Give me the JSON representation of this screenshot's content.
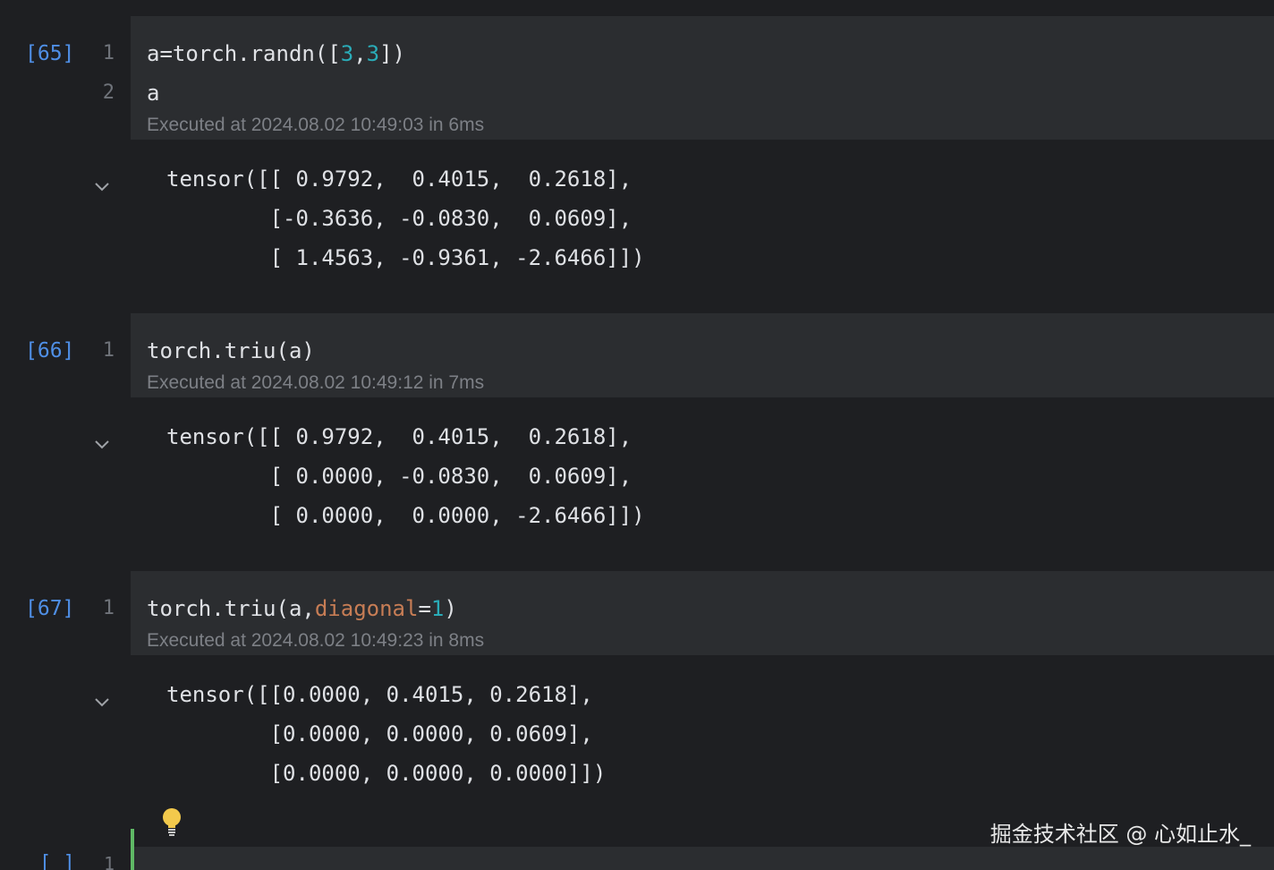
{
  "cells": [
    {
      "exec_count": "[65]",
      "line_numbers": [
        "1",
        "2"
      ],
      "code_lines": [
        [
          {
            "text": "a=torch.randn(["
          },
          {
            "text": "3",
            "cls": "num"
          },
          {
            "text": ","
          },
          {
            "text": "3",
            "cls": "num"
          },
          {
            "text": "])"
          }
        ],
        [
          {
            "text": "a"
          }
        ]
      ],
      "exec_info": "Executed at 2024.08.02 10:49:03 in 6ms",
      "collapse_icon": "chevron-down-icon",
      "output_lines": [
        "tensor([[ 0.9792,  0.4015,  0.2618],",
        "        [-0.3636, -0.0830,  0.0609],",
        "        [ 1.4563, -0.9361, -2.6466]])"
      ]
    },
    {
      "exec_count": "[66]",
      "line_numbers": [
        "1"
      ],
      "code_lines": [
        [
          {
            "text": "torch.triu(a)"
          }
        ]
      ],
      "exec_info": "Executed at 2024.08.02 10:49:12 in 7ms",
      "collapse_icon": "chevron-down-icon",
      "output_lines": [
        "tensor([[ 0.9792,  0.4015,  0.2618],",
        "        [ 0.0000, -0.0830,  0.0609],",
        "        [ 0.0000,  0.0000, -2.6466]])"
      ]
    },
    {
      "exec_count": "[67]",
      "line_numbers": [
        "1"
      ],
      "code_lines": [
        [
          {
            "text": "torch.triu(a,"
          },
          {
            "text": "diagonal",
            "cls": "kw"
          },
          {
            "text": "="
          },
          {
            "text": "1",
            "cls": "num"
          },
          {
            "text": ")"
          }
        ]
      ],
      "exec_info": "Executed at 2024.08.02 10:49:23 in 8ms",
      "collapse_icon": "chevron-down-icon",
      "output_lines": [
        "tensor([[0.0000, 0.4015, 0.2618],",
        "        [0.0000, 0.0000, 0.0609],",
        "        [0.0000, 0.0000, 0.0000]])"
      ]
    }
  ],
  "new_cell": {
    "exec_count": "[ ]",
    "line_number": "1"
  },
  "hint_icon": "lightbulb-icon",
  "watermark": "掘金技术社区 @ 心如止水_",
  "colors": {
    "background": "#1e1f22",
    "code_background": "#2b2d30",
    "exec_count": "#4f8fe6",
    "number_literal": "#2aacb8",
    "keyword_arg": "#c77d55",
    "active_cell_bar": "#5fb865"
  }
}
